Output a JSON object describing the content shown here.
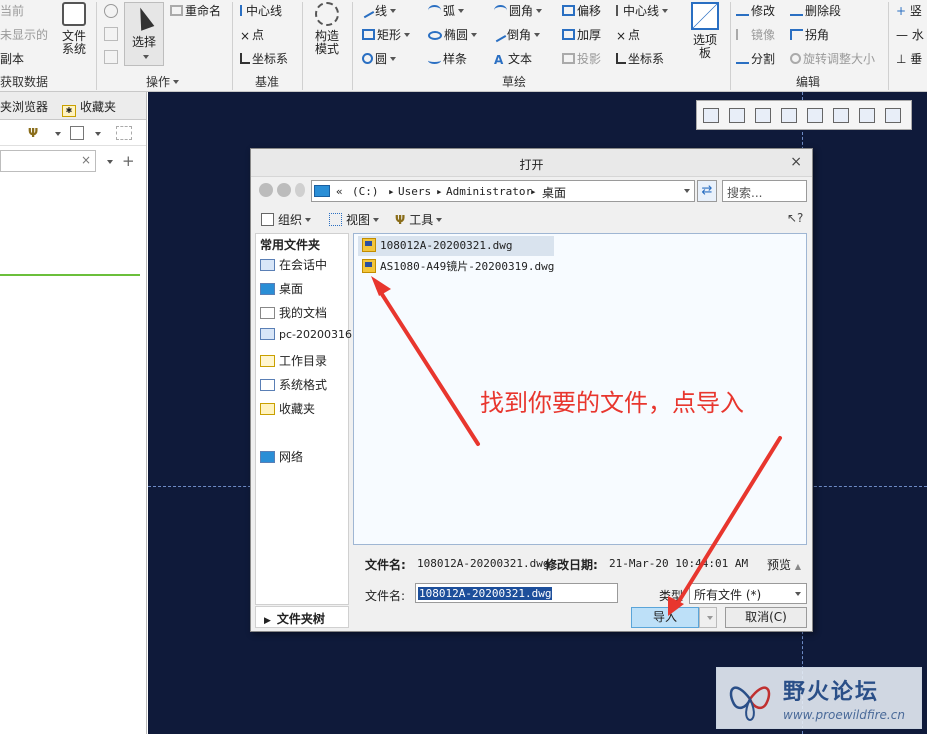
{
  "ribbon": {
    "col0": [
      "当前",
      "未显示的",
      "副本"
    ],
    "get_data": "获取数据",
    "file_system": "文件\n系统",
    "select": "选择",
    "rename": "重命名",
    "operations": "操作",
    "datum_items": [
      "中心线",
      "点",
      "坐标系"
    ],
    "datum": "基准",
    "construct_mode": "构造\n模式",
    "sketch_col1": [
      "线",
      "矩形",
      "圆"
    ],
    "sketch_col2": [
      "弧",
      "椭圆",
      "样条"
    ],
    "sketch_col3": [
      "圆角",
      "倒角",
      "文本"
    ],
    "sketch_col4": [
      "偏移",
      "加厚",
      "投影"
    ],
    "sketch_col5": [
      "中心线",
      "点",
      "坐标系"
    ],
    "sketch": "草绘",
    "palette": "选项\n板",
    "edit_col1": [
      "修改",
      "镜像",
      "分割"
    ],
    "edit_col2": [
      "删除段",
      "拐角",
      "旋转调整大小"
    ],
    "edit": "编辑",
    "constrain": [
      "竖",
      "水",
      "垂"
    ]
  },
  "left_panel": {
    "tab_folder": "夹浏览器",
    "tab_favorites": "收藏夹"
  },
  "dialog": {
    "title": "打开",
    "address": {
      "prefix": "«",
      "parts": [
        "(C:)",
        "Users",
        "Administrator",
        "桌面"
      ]
    },
    "search_placeholder": "搜索...",
    "toolbar": {
      "organize": "组织",
      "view": "视图",
      "tools": "工具"
    },
    "places": {
      "heading": "常用文件夹",
      "items": [
        "在会话中",
        "桌面",
        "我的文档",
        "pc-20200316",
        "工作目录",
        "系统格式",
        "收藏夹",
        "网络"
      ]
    },
    "folder_tree": "文件夹树",
    "files": [
      "108012A-20200321.dwg",
      "AS1080-A49镜片-20200319.dwg"
    ],
    "info": {
      "name_label": "文件名:",
      "name_value": "108012A-20200321.dwg",
      "date_label": "修改日期:",
      "date_value": "21-Mar-20 10:44:01 AM",
      "preview": "预览"
    },
    "filename_label": "文件名:",
    "filename_value": "108012A-20200321.dwg",
    "type_label": "类型",
    "type_value": "所有文件 (*)",
    "import_button": "导入",
    "cancel_button": "取消(C)"
  },
  "annotation": {
    "text": "找到你要的文件，点导入",
    "color": "#e8362e"
  },
  "watermark": {
    "title": "野火论坛",
    "url": "www.proewildfire.cn"
  },
  "colors": {
    "canvas": "#0f1a3a",
    "accent": "#2a6fc2",
    "import_button": "#bde0f8"
  }
}
